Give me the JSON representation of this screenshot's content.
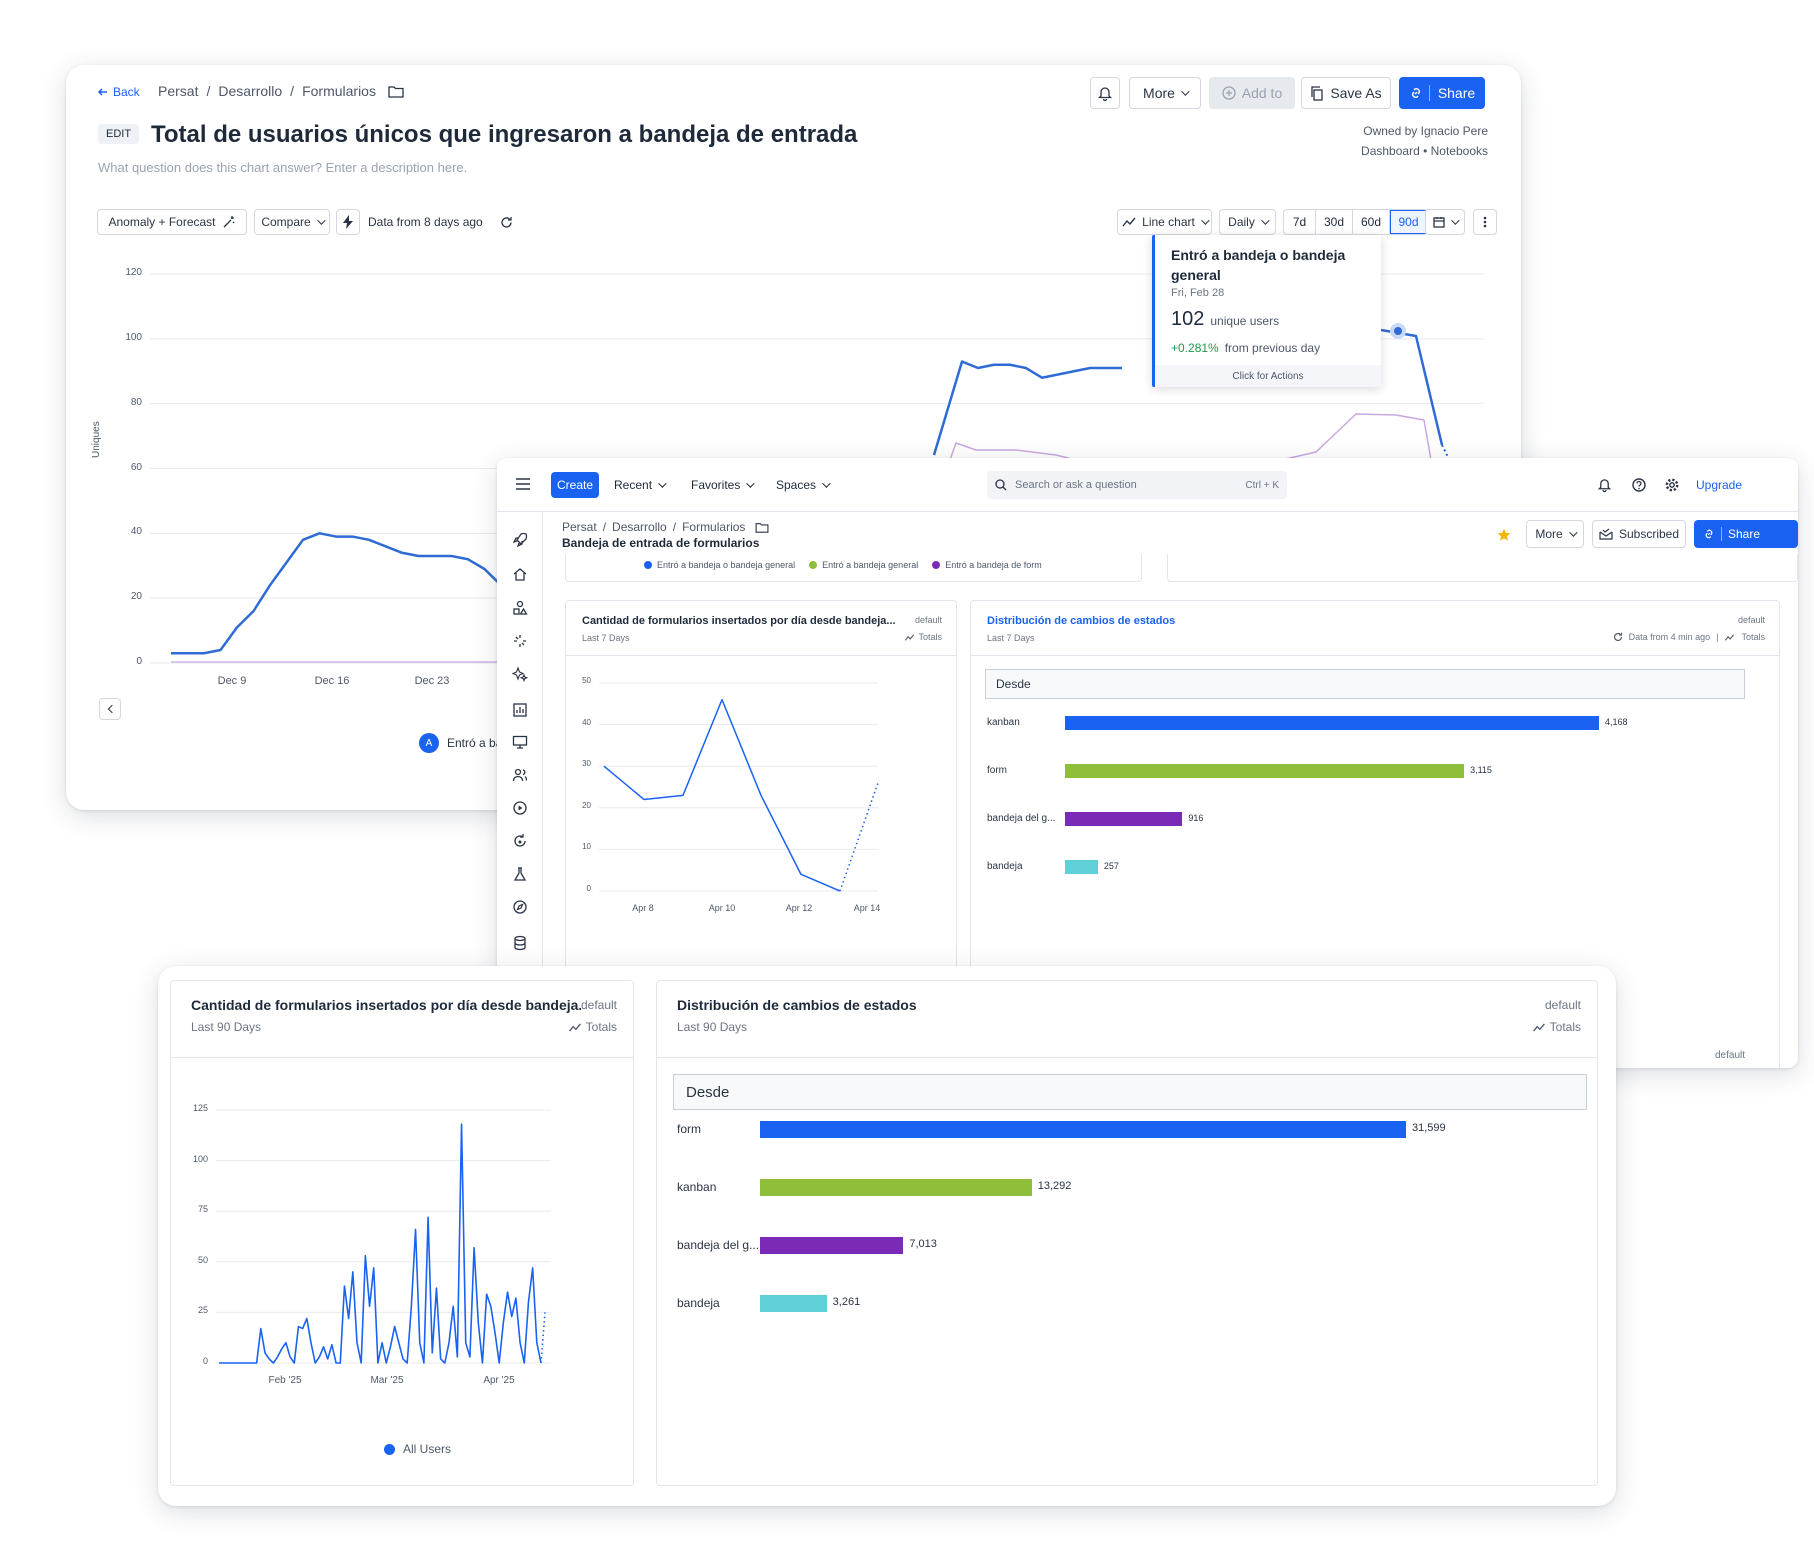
{
  "win1": {
    "back_label": "Back",
    "breadcrumb": [
      "Persat",
      "Desarrollo",
      "Formularios"
    ],
    "edit_badge": "EDIT",
    "title": "Total de usuarios únicos que ingresaron a bandeja de entrada",
    "description_placeholder": "What question does this chart answer? Enter a description here.",
    "more_label": "More",
    "add_to_label": "Add to",
    "save_as_label": "Save As",
    "share_label": "Share",
    "owned_by": "Owned by Ignacio Pere",
    "owner_links": "Dashboard • Notebooks",
    "toolbar": {
      "anomaly_label": "Anomaly + Forecast",
      "compare_label": "Compare",
      "data_from": "Data from 8 days ago",
      "chart_type_label": "Line chart",
      "interval_label": "Daily",
      "ranges": [
        "7d",
        "30d",
        "60d",
        "90d"
      ],
      "active_range": "90d"
    },
    "chart_data": {
      "type": "line",
      "ylabel": "Uniques",
      "y_ticks": [
        0,
        20,
        40,
        60,
        80,
        100,
        120
      ],
      "x_ticks": [
        "Dec 9",
        "Dec 16",
        "Dec 23"
      ],
      "series": [
        {
          "name": "Entró a bandeja o bandeja general",
          "color": "#2e6bd4",
          "values": [
            3,
            3,
            3,
            4,
            11,
            16,
            24,
            31,
            38,
            40,
            39,
            39,
            38,
            36,
            34,
            33,
            33,
            33,
            32,
            29,
            24,
            24,
            23
          ]
        },
        {
          "name": "Entró a bandeja o bandeja general (late)",
          "color": "#2e6bd4",
          "values": [
            93,
            91,
            92,
            92,
            91,
            88,
            89,
            90,
            91,
            91,
            91,
            91
          ]
        },
        {
          "name": "Entró a bandeja de form",
          "color": "#c9a8e0",
          "values": [
            66,
            64,
            64,
            63,
            63
          ]
        }
      ],
      "legend_label": "Entró a ba",
      "legend_letter": "A"
    },
    "tooltip": {
      "title": "Entró a bandeja o bandeja general",
      "date": "Fri, Feb 28",
      "value": "102",
      "unit": "unique users",
      "change": "+0.281%",
      "change_suffix": "from previous day",
      "action": "Click for Actions"
    }
  },
  "win2": {
    "nav": {
      "create_label": "Create",
      "recent_label": "Recent",
      "favorites_label": "Favorites",
      "spaces_label": "Spaces",
      "search_placeholder": "Search or ask a question",
      "search_shortcut": "Ctrl + K",
      "upgrade_label": "Upgrade"
    },
    "breadcrumb": [
      "Persat",
      "Desarrollo",
      "Formularios"
    ],
    "title": "Bandeja de entrada de formularios",
    "more_label": "More",
    "subscribed_label": "Subscribed",
    "share_label": "Share",
    "legend": [
      {
        "label": "Entró a bandeja o bandeja general",
        "color": "#1a62f2"
      },
      {
        "label": "Entró a bandeja general",
        "color": "#8fbf3a"
      },
      {
        "label": "Entró a bandeja de form",
        "color": "#7b2ab8"
      }
    ],
    "line_card": {
      "title": "Cantidad de formularios insertados por día desde bandeja...",
      "badge": "default",
      "subtitle": "Last 7 Days",
      "totals_label": "Totals",
      "chart_data": {
        "type": "line",
        "y_ticks": [
          0,
          10,
          20,
          30,
          40,
          50
        ],
        "x_ticks": [
          "Apr 8",
          "Apr 10",
          "Apr 12",
          "Apr 14"
        ],
        "values": [
          30,
          22,
          23,
          46,
          23,
          4,
          0
        ],
        "forecast": [
          0,
          26
        ],
        "color": "#1a62f2"
      }
    },
    "bar_card": {
      "title": "Distribución de cambios de estados",
      "badge": "default",
      "subtitle": "Last 7 Days",
      "data_from": "Data from 4 min ago",
      "totals_label": "Totals",
      "header": "Desde",
      "chart_data": {
        "type": "bar",
        "categories": [
          "kanban",
          "form",
          "bandeja del g...",
          "bandeja"
        ],
        "values": [
          4168,
          3115,
          916,
          257
        ],
        "value_labels": [
          "4,168",
          "3,115",
          "916",
          "257"
        ],
        "colors": [
          "#1a62f2",
          "#8fbf3a",
          "#7b2ab8",
          "#5fd0d8"
        ]
      }
    },
    "footer_badge": "default"
  },
  "win3": {
    "line_card": {
      "title": "Cantidad de formularios insertados por día desde bandeja...",
      "badge": "default",
      "subtitle": "Last 90 Days",
      "totals_label": "Totals",
      "legend_label": "All Users",
      "chart_data": {
        "type": "line",
        "y_ticks": [
          0,
          25,
          50,
          75,
          100,
          125
        ],
        "x_ticks": [
          "Feb '25",
          "Mar '25",
          "Apr '25"
        ],
        "values": [
          0,
          0,
          0,
          0,
          0,
          0,
          0,
          0,
          0,
          0,
          17,
          5,
          2,
          0,
          3,
          7,
          10,
          3,
          0,
          18,
          17,
          22,
          10,
          0,
          3,
          8,
          2,
          9,
          0,
          0,
          38,
          22,
          45,
          10,
          0,
          53,
          28,
          47,
          0,
          10,
          0,
          8,
          18,
          10,
          2,
          0,
          28,
          66,
          10,
          0,
          72,
          5,
          37,
          2,
          0,
          10,
          28,
          3,
          118,
          10,
          3,
          57,
          20,
          0,
          34,
          28,
          15,
          0,
          20,
          35,
          23,
          32,
          10,
          0,
          30,
          47,
          10,
          0
        ],
        "forecast": [
          0,
          25
        ],
        "color": "#1a62f2"
      }
    },
    "bar_card": {
      "title": "Distribución de cambios de estados",
      "badge": "default",
      "subtitle": "Last 90 Days",
      "totals_label": "Totals",
      "header": "Desde",
      "chart_data": {
        "type": "bar",
        "categories": [
          "form",
          "kanban",
          "bandeja del g...",
          "bandeja"
        ],
        "values": [
          31599,
          13292,
          7013,
          3261
        ],
        "value_labels": [
          "31,599",
          "13,292",
          "7,013",
          "3,261"
        ],
        "colors": [
          "#1a62f2",
          "#8fbf3a",
          "#7b2ab8",
          "#5fd0d8"
        ]
      }
    }
  }
}
